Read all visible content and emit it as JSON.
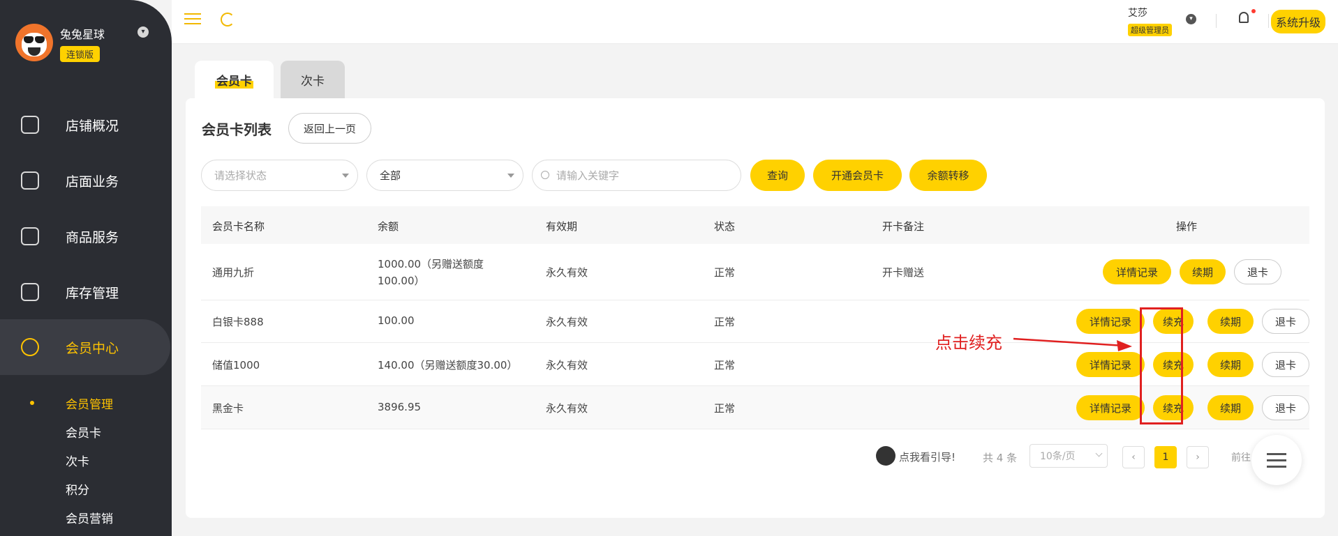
{
  "sidebar": {
    "brand_name": "兔兔星球",
    "brand_badge": "连锁版",
    "nav": [
      {
        "label": "店铺概况",
        "icon": "monitor-icon"
      },
      {
        "label": "店面业务",
        "icon": "home-icon"
      },
      {
        "label": "商品服务",
        "icon": "bag-icon"
      },
      {
        "label": "库存管理",
        "icon": "archive-icon"
      },
      {
        "label": "会员中心",
        "icon": "member-icon",
        "active": true
      }
    ],
    "sub": [
      {
        "label": "会员管理",
        "active": true
      },
      {
        "label": "会员卡"
      },
      {
        "label": "次卡"
      },
      {
        "label": "积分"
      },
      {
        "label": "会员营销"
      }
    ]
  },
  "topbar": {
    "user_name": "艾莎",
    "user_role": "超级管理员",
    "upgrade": "系统升级"
  },
  "tabs": [
    {
      "label": "会员卡",
      "active": true
    },
    {
      "label": "次卡"
    }
  ],
  "panel": {
    "title": "会员卡列表",
    "back": "返回上一页",
    "status_placeholder": "请选择状态",
    "type_value": "全部",
    "search_placeholder": "请输入关键字",
    "btn_query": "查询",
    "btn_open": "开通会员卡",
    "btn_transfer": "余额转移"
  },
  "table": {
    "headers": [
      "会员卡名称",
      "余额",
      "有效期",
      "状态",
      "开卡备注",
      "操作"
    ],
    "rows": [
      {
        "name": "通用九折",
        "balance": "1000.00（另赠送额度100.00）",
        "validity": "永久有效",
        "status": "正常",
        "note": "开卡赠送",
        "ops": [
          "详情记录",
          "续期",
          "退卡"
        ]
      },
      {
        "name": "白银卡888",
        "balance": "100.00",
        "validity": "永久有效",
        "status": "正常",
        "note": "",
        "ops": [
          "详情记录",
          "续充",
          "续期",
          "退卡"
        ]
      },
      {
        "name": "储值1000",
        "balance": "140.00（另赠送额度30.00）",
        "validity": "永久有效",
        "status": "正常",
        "note": "",
        "ops": [
          "详情记录",
          "续充",
          "续期",
          "退卡"
        ]
      },
      {
        "name": "黑金卡",
        "balance": "3896.95",
        "validity": "永久有效",
        "status": "正常",
        "note": "",
        "ops": [
          "详情记录",
          "续充",
          "续期",
          "退卡"
        ]
      }
    ]
  },
  "pagination": {
    "guide": "点我看引导!",
    "total": "共 4 条",
    "page_size": "10条/页",
    "current": "1",
    "goto": "前往"
  },
  "annotation": {
    "text": "点击续充",
    "color": "#e02020"
  },
  "colors": {
    "accent": "#ffd100",
    "sidebar": "#2b2d33",
    "active_text": "#ffc300"
  }
}
